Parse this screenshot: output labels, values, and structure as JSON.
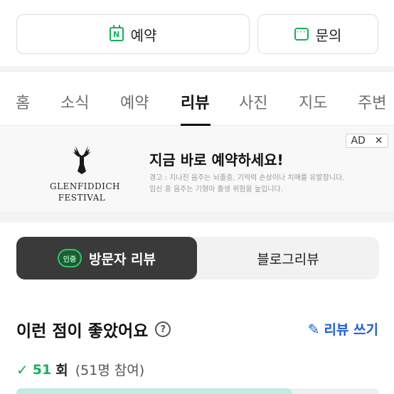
{
  "actions": {
    "reserve_label": "예약",
    "reserve_icon_letter": "N",
    "inquiry_label": "문의",
    "inquiry_icon_dots": "···"
  },
  "tabs": [
    {
      "label": "홈"
    },
    {
      "label": "소식"
    },
    {
      "label": "예약"
    },
    {
      "label": "리뷰",
      "active": true
    },
    {
      "label": "사진"
    },
    {
      "label": "지도"
    },
    {
      "label": "주변"
    }
  ],
  "ad": {
    "badge": "AD",
    "close": "✕",
    "logo_line1": "GLENFIDDICH",
    "logo_line2": "FESTIVAL",
    "title": "지금 바로 예약하세요!",
    "warning_line1": "경고 : 지나친 음주는 뇌졸중, 기억력 손상이나 치매를 유발합니다.",
    "warning_line2": "임신 중 음주는 기형아 출생 위험을 높입니다."
  },
  "review_toggle": {
    "cert_badge": "인증",
    "visitor_label": "방문자 리뷰",
    "blog_label": "블로그리뷰"
  },
  "section": {
    "title": "이런 점이 좋았어요",
    "help_symbol": "?",
    "write_label": "리뷰 쓰기"
  },
  "stat": {
    "count": "51",
    "unit": "회",
    "participants": "(51명 참여)",
    "fill_fraction": 0.76
  },
  "colors": {
    "accent_green": "#14b25b",
    "link_blue": "#1a5dd8",
    "toggle_active_bg": "#3a3a3a",
    "bar_fill": "#bfece0"
  }
}
